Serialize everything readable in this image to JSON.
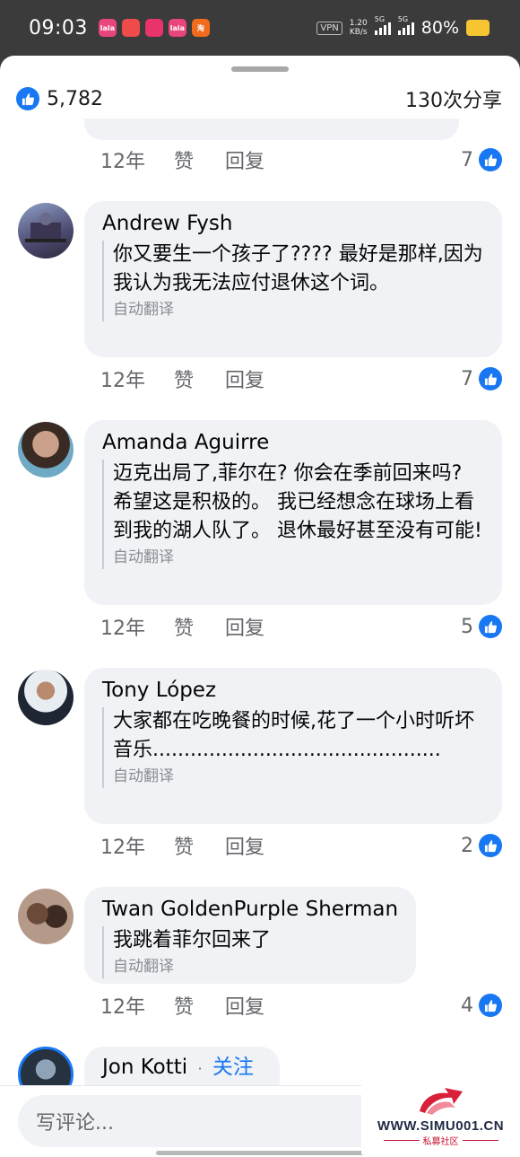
{
  "status_bar": {
    "time": "09:03",
    "app_icons": [
      {
        "name": "app-icon-lala",
        "color": "#e8457a",
        "label": "lala"
      },
      {
        "name": "app-icon-red-packet",
        "color": "#f04b4b",
        "label": ""
      },
      {
        "name": "app-icon-heart",
        "color": "#e8336b",
        "label": ""
      },
      {
        "name": "app-icon-lala-2",
        "color": "#e8457a",
        "label": "lala"
      },
      {
        "name": "app-icon-taobao",
        "color": "#f26a1b",
        "label": "淘"
      }
    ],
    "vpn": "VPN",
    "net_speed": "1.20",
    "net_speed_unit": "KB/s",
    "signal_1": "5G",
    "signal_2": "5G",
    "battery": "80%"
  },
  "header": {
    "likes": "5,782",
    "shares": "130次分享"
  },
  "labels": {
    "like": "赞",
    "reply": "回复",
    "auto_translated": "自动翻译"
  },
  "prev_comment_actions": {
    "age": "12年",
    "reactions": "7"
  },
  "comments": [
    {
      "author": "Andrew Fysh",
      "text": "你又要生一个孩子了???? 最好是那样,因为我认为我无法应付退休这个词。",
      "age": "12年",
      "reactions": "7"
    },
    {
      "author": "Amanda Aguirre",
      "text": "迈克出局了,菲尔在? 你会在季前回来吗? 希望这是积极的。 我已经想念在球场上看到我的湖人队了。 退休最好甚至没有可能!",
      "age": "12年",
      "reactions": "5"
    },
    {
      "author": "Tony López",
      "text": "大家都在吃晚餐的时候,花了一个小时听坏音乐..............................................",
      "age": "12年",
      "reactions": "2"
    },
    {
      "author": "Twan GoldenPurple Sherman",
      "text": "我跳着菲尔回来了",
      "age": "12年",
      "reactions": "4"
    },
    {
      "author": "Jon Kotti",
      "follow_separator": "·",
      "follow": "关注"
    }
  ],
  "footer": {
    "comment_placeholder": "写评论..."
  },
  "watermark": {
    "url": "WWW.SIMU001.CN",
    "sub": "私募社区"
  },
  "colors": {
    "accent": "#1877f2",
    "bubble": "#f0f2f5",
    "secondary_text": "#65676b"
  }
}
